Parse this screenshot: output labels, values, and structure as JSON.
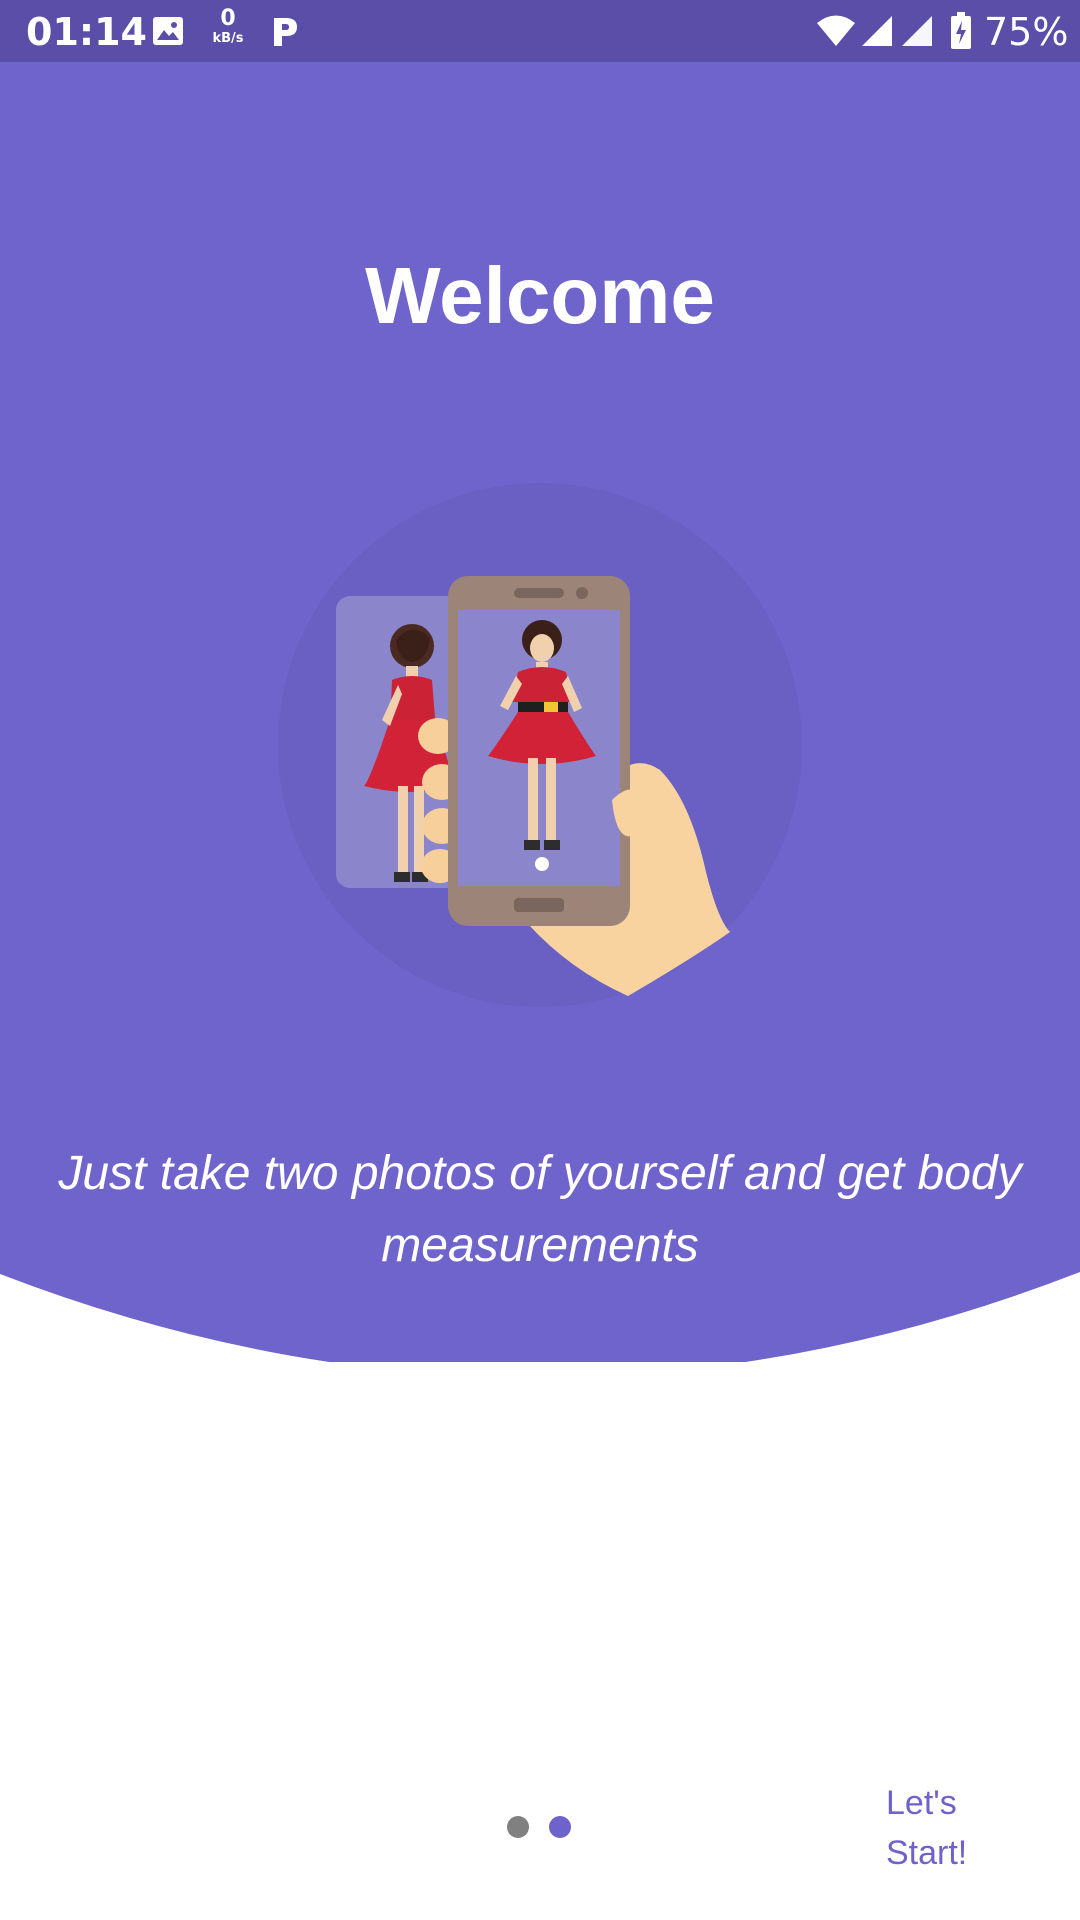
{
  "status_bar": {
    "time": "01:14",
    "speed_value": "0",
    "speed_unit": "kB/s",
    "battery_percent": "75%",
    "icons": [
      "image-icon",
      "data-speed-icon",
      "p-app-icon",
      "wifi-icon",
      "signal-icon",
      "signal-icon",
      "battery-charging-icon"
    ]
  },
  "welcome": {
    "title": "Welcome",
    "subtitle": "Just take two photos of yourself and get body measurements",
    "illustration": "phone-photo-illustration"
  },
  "pager": {
    "page_count": 2,
    "active_index": 1
  },
  "actions": {
    "start_label": "Let's Start!"
  },
  "colors": {
    "status_bar": "#5a4ea8",
    "primary": "#6f63cc",
    "circle": "#6a5fc2",
    "inactive_dot": "#808080",
    "active_dot": "#6e63ca"
  }
}
